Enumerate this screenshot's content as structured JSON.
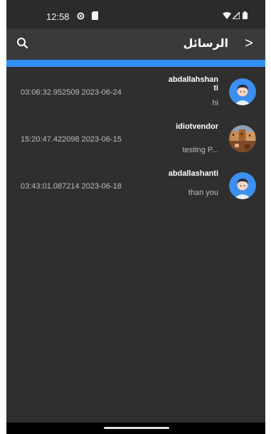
{
  "status_bar": {
    "time": "12:58",
    "icons": [
      "settings-gear-icon",
      "sd-card-icon",
      "wifi-icon",
      "signal-icon",
      "battery-icon"
    ]
  },
  "app_bar": {
    "title": "الرسائل",
    "back_glyph": ">",
    "search_icon": "search-icon"
  },
  "colors": {
    "background": "#2f2f2f",
    "app_bar": "#3a3a3a",
    "accent": "#2f8ff0",
    "avatar_blue": "#3d8ff0"
  },
  "conversations": [
    {
      "name": "abdallahshanti",
      "preview": "hi",
      "timestamp": "03:06:32.952509 2023-06-24",
      "avatar": "default-avatar-icon"
    },
    {
      "name": "idiotvendor",
      "preview": "testing P...",
      "timestamp": "15:20:47.422098 2023-06-15",
      "avatar": "photo-avatar"
    },
    {
      "name": "abdallashanti",
      "preview": "than you",
      "timestamp": "03:43:01.087214 2023-06-18",
      "avatar": "default-avatar-icon"
    }
  ]
}
